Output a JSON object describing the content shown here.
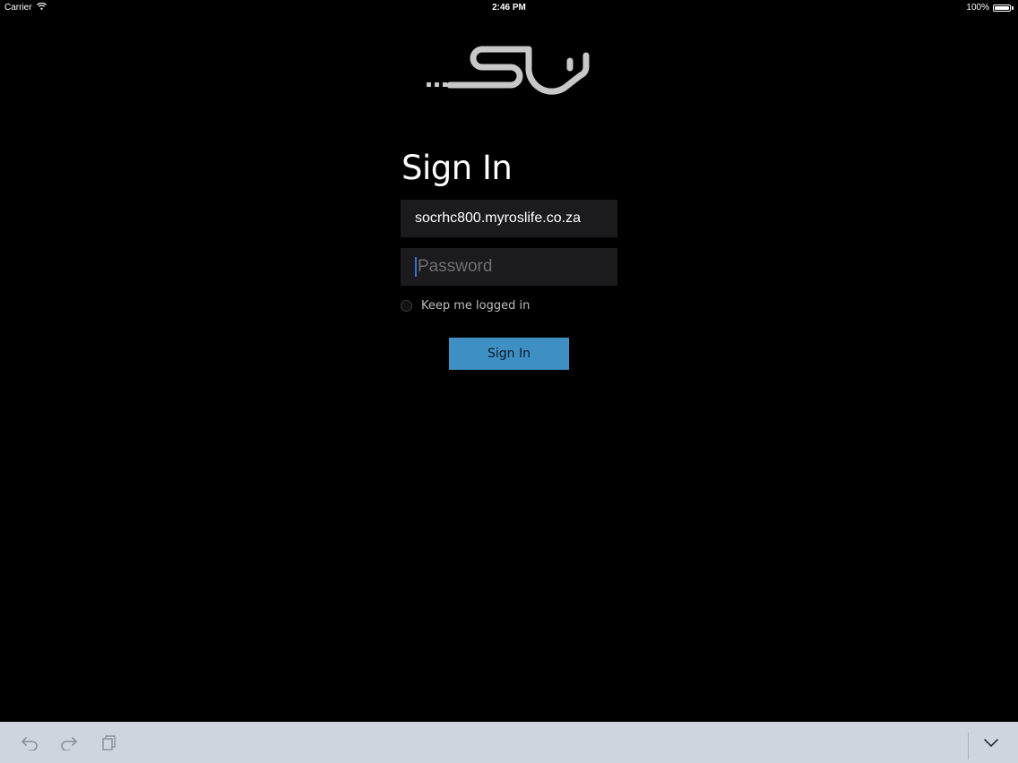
{
  "status_bar": {
    "carrier": "Carrier",
    "time": "2:46 PM",
    "battery_text": "100%",
    "battery_level": 1.0
  },
  "login": {
    "title": "Sign In",
    "server_value": "socrhc800.myroslife.co.za",
    "password_placeholder": "Password",
    "keep_logged_in_label": "Keep me logged in",
    "keep_logged_in_checked": false,
    "submit_label": "Sign In"
  },
  "toolbar": {
    "icons": [
      "undo-icon",
      "redo-icon",
      "paste-icon",
      "keyboard-dismiss-icon"
    ]
  },
  "colors": {
    "background": "#000000",
    "field_bg": "#1b1b1d",
    "button_bg": "#3d8fc4",
    "toolbar_bg": "#cfd5df",
    "logo": "#c8c8c8"
  }
}
